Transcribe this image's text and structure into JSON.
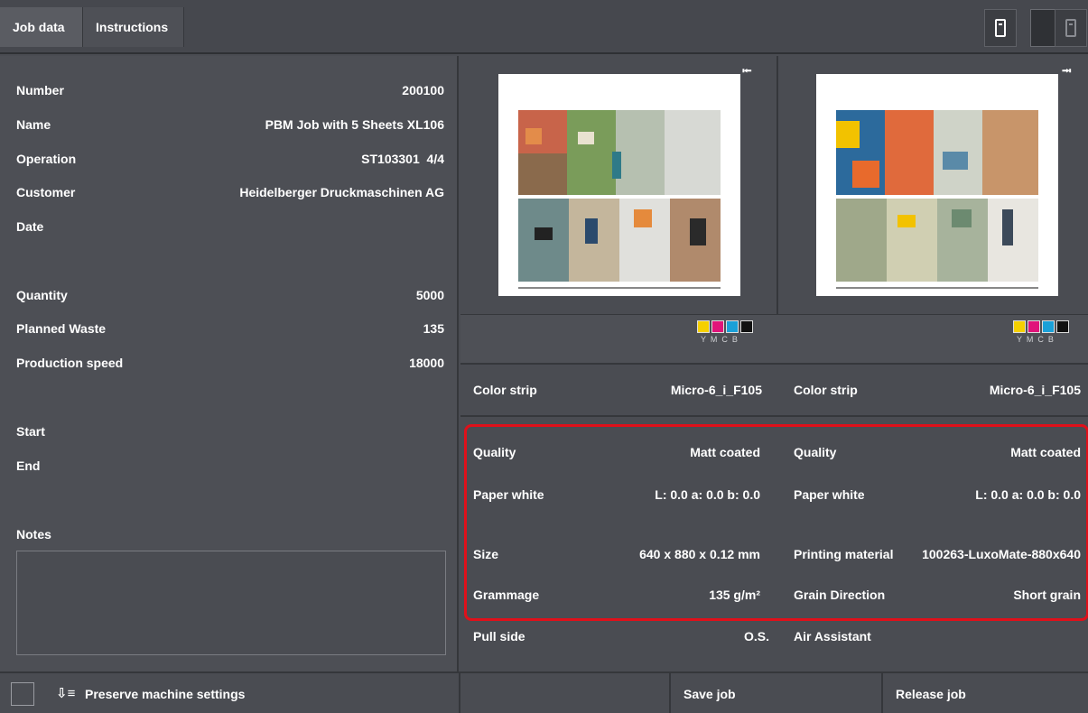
{
  "tabs": {
    "job_data": "Job data",
    "instructions": "Instructions"
  },
  "job": {
    "number_label": "Number",
    "number": "200100",
    "name_label": "Name",
    "name": "PBM Job with 5 Sheets XL106",
    "operation_label": "Operation",
    "operation": "ST103301  4/4",
    "customer_label": "Customer",
    "customer": "Heidelberger Druckmaschinen AG",
    "date_label": "Date",
    "quantity_label": "Quantity",
    "quantity": "5000",
    "waste_label": "Planned Waste",
    "waste": "135",
    "speed_label": "Production speed",
    "speed": "18000",
    "start_label": "Start",
    "end_label": "End",
    "notes_label": "Notes"
  },
  "swatches": {
    "colors": [
      "#f5d000",
      "#e0147a",
      "#1aa0d8",
      "#111111"
    ],
    "labels": "Y  M  C  B"
  },
  "front": {
    "color_strip_label": "Color strip",
    "color_strip": "Micro-6_i_F105",
    "quality_label": "Quality",
    "quality": "Matt coated",
    "paper_white_label": "Paper white",
    "paper_white": "L: 0.0 a: 0.0 b: 0.0",
    "size_label": "Size",
    "size": "640 x 880 x 0.12 mm",
    "grammage_label": "Grammage",
    "grammage": "135 g/m²",
    "pull_side_label": "Pull side",
    "pull_side": "O.S."
  },
  "back": {
    "color_strip_label": "Color strip",
    "color_strip": "Micro-6_i_F105",
    "quality_label": "Quality",
    "quality": "Matt coated",
    "paper_white_label": "Paper white",
    "paper_white": "L: 0.0 a: 0.0 b: 0.0",
    "material_label": "Printing material",
    "material": "100263-LuxoMate-880x640",
    "grain_label": "Grain Direction",
    "grain": "Short grain",
    "air_label": "Air Assistant"
  },
  "bottom": {
    "preserve_label": "Preserve machine settings",
    "save_label": "Save job",
    "release_label": "Release job"
  },
  "highlight_color": "#e0101a"
}
